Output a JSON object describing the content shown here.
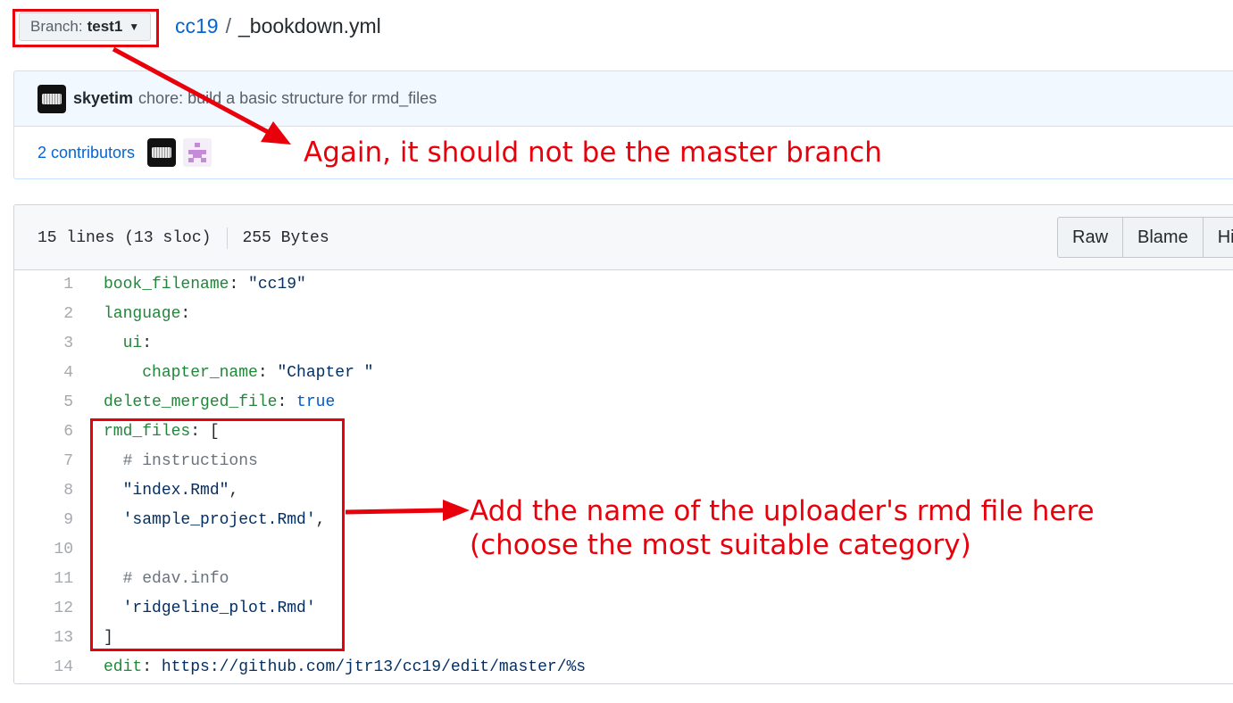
{
  "branch": {
    "label": "Branch:",
    "value": "test1"
  },
  "breadcrumb": {
    "repo": "cc19",
    "separator": "/",
    "file": "_bookdown.yml"
  },
  "commit": {
    "author": "skyetim",
    "message": "chore: build a basic structure for rmd_files",
    "contributors_label": "2 contributors"
  },
  "file": {
    "lines_info": "15 lines (13 sloc)",
    "size": "255 Bytes",
    "buttons": [
      "Raw",
      "Blame",
      "Hi"
    ]
  },
  "code": [
    {
      "num": "1",
      "parts": [
        {
          "t": "book_filename",
          "c": "k"
        },
        {
          "t": ": ",
          "c": "p"
        },
        {
          "t": "\"cc19\"",
          "c": "s"
        }
      ]
    },
    {
      "num": "2",
      "parts": [
        {
          "t": "language",
          "c": "k"
        },
        {
          "t": ":",
          "c": "p"
        }
      ]
    },
    {
      "num": "3",
      "parts": [
        {
          "t": "  ",
          "c": "p"
        },
        {
          "t": "ui",
          "c": "k"
        },
        {
          "t": ":",
          "c": "p"
        }
      ]
    },
    {
      "num": "4",
      "parts": [
        {
          "t": "    ",
          "c": "p"
        },
        {
          "t": "chapter_name",
          "c": "k"
        },
        {
          "t": ": ",
          "c": "p"
        },
        {
          "t": "\"Chapter \"",
          "c": "s"
        }
      ]
    },
    {
      "num": "5",
      "parts": [
        {
          "t": "delete_merged_file",
          "c": "k"
        },
        {
          "t": ": ",
          "c": "p"
        },
        {
          "t": "true",
          "c": "b"
        }
      ]
    },
    {
      "num": "6",
      "parts": [
        {
          "t": "rmd_files",
          "c": "k"
        },
        {
          "t": ": [",
          "c": "p"
        }
      ]
    },
    {
      "num": "7",
      "parts": [
        {
          "t": "  ",
          "c": "p"
        },
        {
          "t": "# instructions",
          "c": "c"
        }
      ]
    },
    {
      "num": "8",
      "parts": [
        {
          "t": "  ",
          "c": "p"
        },
        {
          "t": "\"index.Rmd\"",
          "c": "s"
        },
        {
          "t": ",",
          "c": "p"
        }
      ]
    },
    {
      "num": "9",
      "parts": [
        {
          "t": "  ",
          "c": "p"
        },
        {
          "t": "'sample_project.Rmd'",
          "c": "s"
        },
        {
          "t": ",",
          "c": "p"
        }
      ]
    },
    {
      "num": "10",
      "parts": []
    },
    {
      "num": "11",
      "parts": [
        {
          "t": "  ",
          "c": "p"
        },
        {
          "t": "# edav.info",
          "c": "c"
        }
      ]
    },
    {
      "num": "12",
      "parts": [
        {
          "t": "  ",
          "c": "p"
        },
        {
          "t": "'ridgeline_plot.Rmd'",
          "c": "s"
        }
      ]
    },
    {
      "num": "13",
      "parts": [
        {
          "t": "]",
          "c": "p"
        }
      ]
    },
    {
      "num": "14",
      "parts": [
        {
          "t": "edit",
          "c": "k"
        },
        {
          "t": ": ",
          "c": "p"
        },
        {
          "t": "https://github.com/jtr13/cc19/edit/master/%s",
          "c": "s"
        }
      ]
    }
  ],
  "annotations": {
    "branch_note": "Again, it should not be the master branch",
    "rmd_note_line1": "Add the name of the uploader's rmd file here",
    "rmd_note_line2": "(choose the most suitable category)"
  },
  "colors": {
    "annotation": "#e8000b",
    "link": "#0366d6",
    "yaml_key": "#22863a",
    "string": "#032f62",
    "comment": "#6a737d",
    "boolean": "#005cc5"
  }
}
